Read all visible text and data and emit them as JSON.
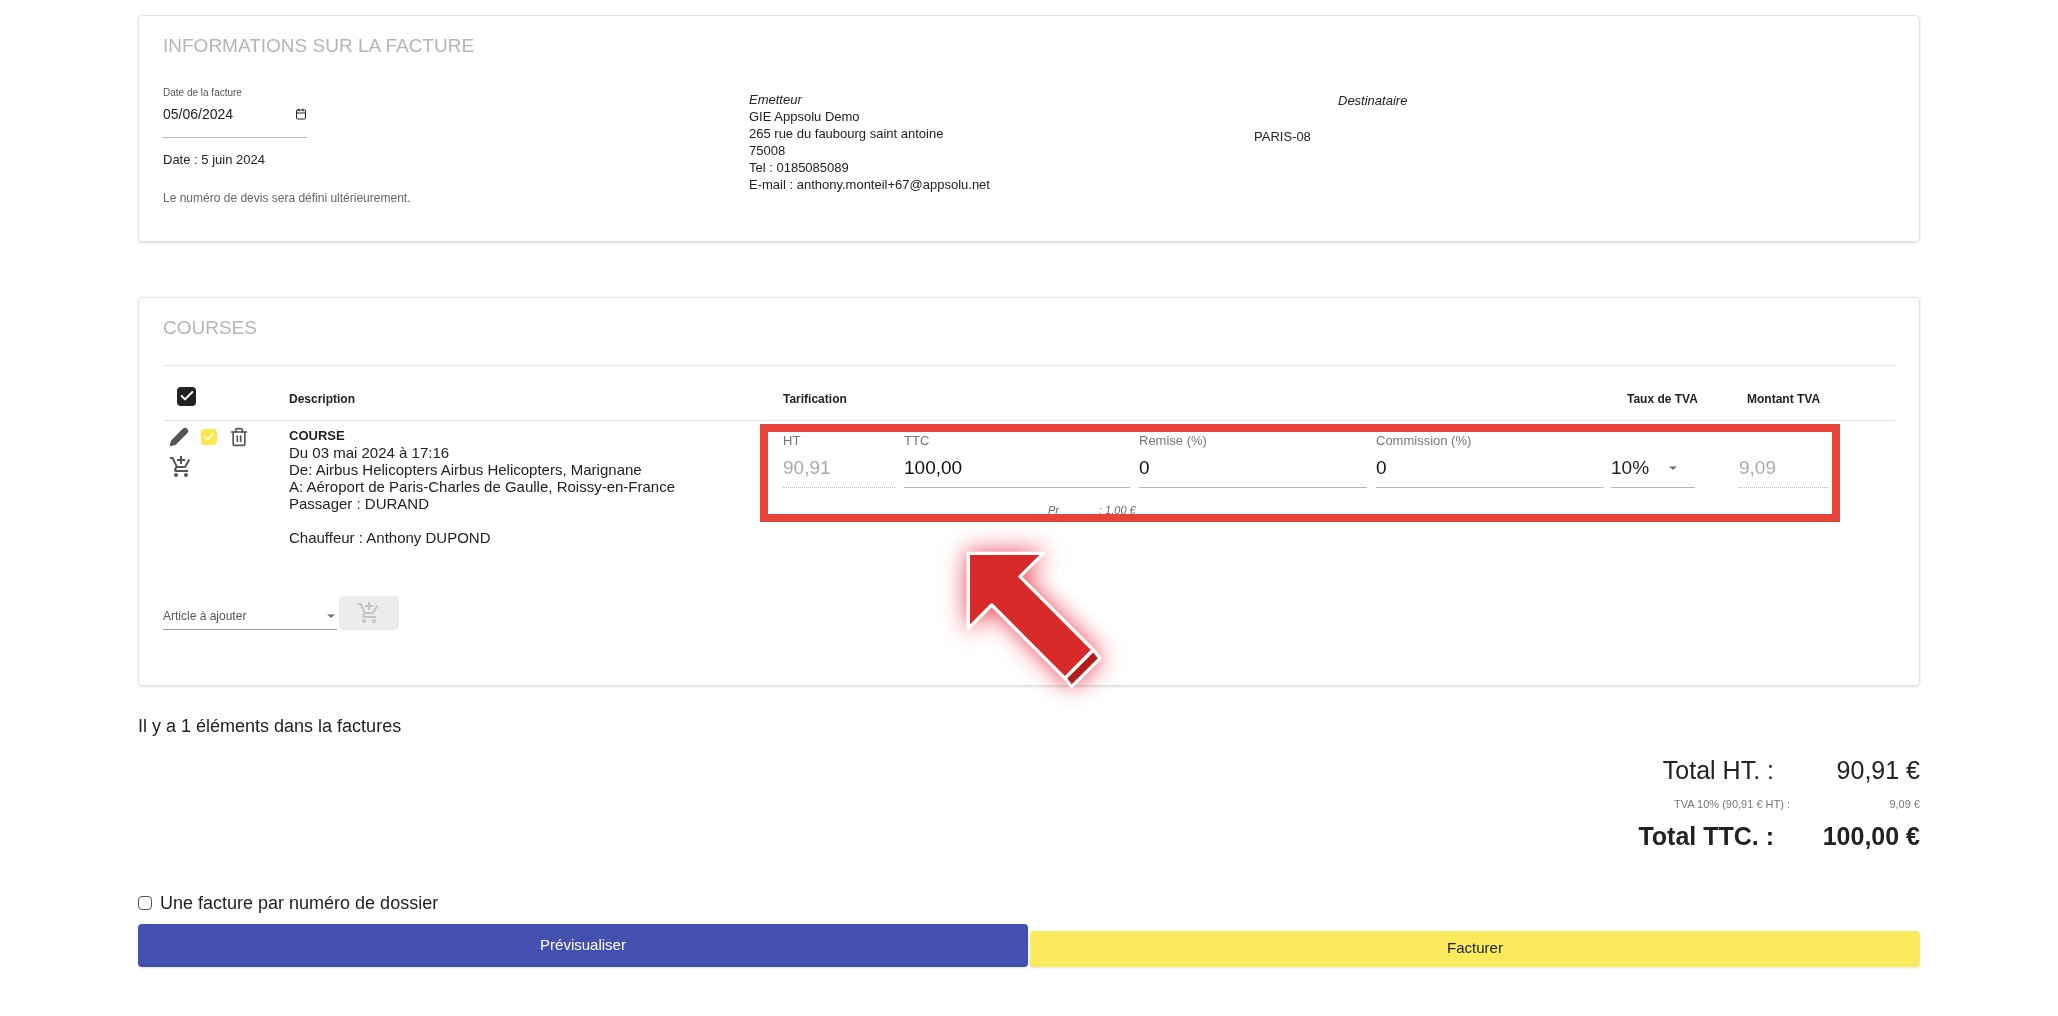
{
  "invoice_info": {
    "title": "INFORMATIONS SUR LA FACTURE",
    "date_field": {
      "label": "Date de la facture",
      "value": "05/06/2024"
    },
    "date_text": "Date : 5 juin 2024",
    "quote_note": "Le numéro de devis sera défini ultérieurement.",
    "issuer": {
      "heading": "Emetteur",
      "lines": [
        "GIE Appsolu Demo",
        "265 rue du faubourg saint antoine",
        "75008",
        "Tel : 0185085089",
        "E-mail : anthony.monteil+67@appsolu.net"
      ]
    },
    "city": "PARIS-08",
    "recipient": {
      "heading": "Destinataire"
    }
  },
  "courses": {
    "title": "COURSES",
    "select_all": {
      "checked": true
    },
    "columns": [
      "Description",
      "Tarification",
      "Taux de TVA",
      "Montant TVA"
    ],
    "rows": [
      {
        "selected": true,
        "type_label": "COURSE",
        "lines": [
          "Du 03 mai 2024 à 17:16",
          "De: Airbus Helicopters Airbus Helicopters, Marignane",
          "A: Aéroport de Paris-Charles de Gaulle, Roissy-en-France",
          "Passager : DURAND"
        ],
        "driver": "Chauffeur : Anthony DUPOND",
        "fields": [
          {
            "kind": "readonly",
            "label": "HT",
            "value": "90,91"
          },
          {
            "kind": "input",
            "label": "TTC",
            "value": "100,00"
          },
          {
            "kind": "input",
            "label": "Remise (%)",
            "value": "0"
          },
          {
            "kind": "input",
            "label": "Commission (%)",
            "value": "0"
          }
        ],
        "vat_rate": "10%",
        "vat_amount": "9,09",
        "price_note_start": "Pr",
        "price_note_end": ": 1,00 €"
      }
    ],
    "article_select": {
      "placeholder": "Article à ajouter"
    }
  },
  "item_count": "Il y a 1 éléments dans la factures",
  "totals": [
    {
      "kind": "main",
      "label": "Total HT. :",
      "value": "90,91 €"
    },
    {
      "kind": "sub",
      "label": "TVA 10% (90,91 € HT) :",
      "value": "9,09 €"
    },
    {
      "kind": "grand",
      "label": "Total TTC. :",
      "value": "100,00 €"
    }
  ],
  "per_file_option": {
    "label": "Une facture par numéro de dossier",
    "checked": false
  },
  "buttons": [
    {
      "kind": "primary",
      "label": "Prévisualiser"
    },
    {
      "kind": "accent",
      "label": "Facturer"
    }
  ]
}
